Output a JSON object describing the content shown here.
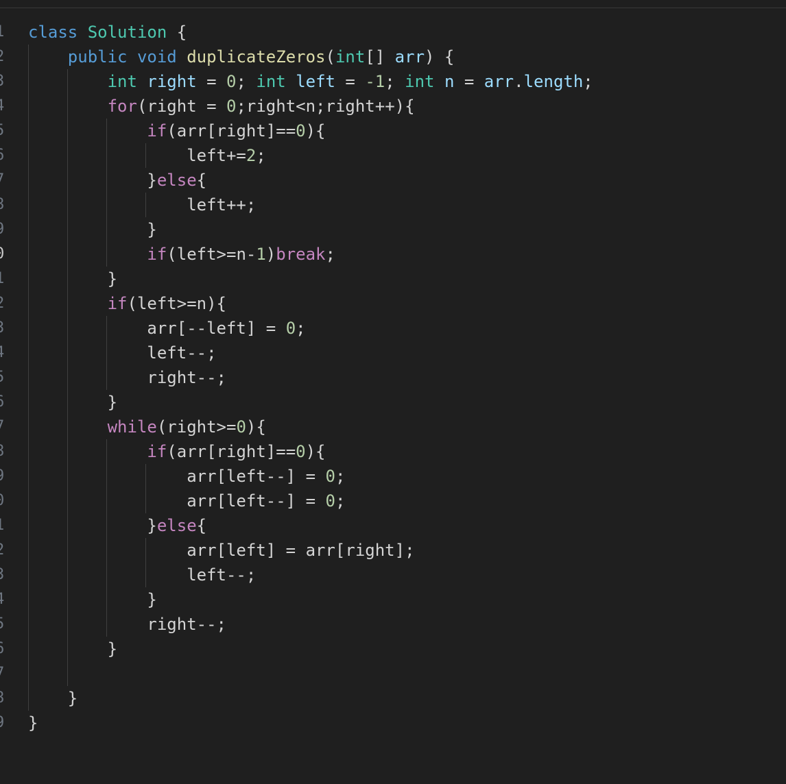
{
  "editor": {
    "line_numbers": [
      "1",
      "2",
      "3",
      "4",
      "5",
      "6",
      "7",
      "8",
      "9",
      "0",
      "1",
      "2",
      "3",
      "4",
      "5",
      "6",
      "7",
      "8",
      "9",
      "0",
      "1",
      "2",
      "3",
      "4",
      "5",
      "6",
      "7",
      "8",
      "9"
    ],
    "active_line_index": 9,
    "language": "java",
    "lines": [
      [
        {
          "t": "class",
          "c": "kw"
        },
        {
          "t": " "
        },
        {
          "t": "Solution",
          "c": "ty"
        },
        {
          "t": " {"
        }
      ],
      [
        {
          "t": "    "
        },
        {
          "t": "public",
          "c": "kw"
        },
        {
          "t": " "
        },
        {
          "t": "void",
          "c": "kw"
        },
        {
          "t": " "
        },
        {
          "t": "duplicateZeros",
          "c": "fn"
        },
        {
          "t": "("
        },
        {
          "t": "int",
          "c": "ty"
        },
        {
          "t": "[] "
        },
        {
          "t": "arr",
          "c": "va"
        },
        {
          "t": ") {"
        }
      ],
      [
        {
          "t": "        "
        },
        {
          "t": "int",
          "c": "ty"
        },
        {
          "t": " "
        },
        {
          "t": "right",
          "c": "va"
        },
        {
          "t": " = "
        },
        {
          "t": "0",
          "c": "nu"
        },
        {
          "t": "; "
        },
        {
          "t": "int",
          "c": "ty"
        },
        {
          "t": " "
        },
        {
          "t": "left",
          "c": "va"
        },
        {
          "t": " = "
        },
        {
          "t": "-1",
          "c": "nu"
        },
        {
          "t": "; "
        },
        {
          "t": "int",
          "c": "ty"
        },
        {
          "t": " "
        },
        {
          "t": "n",
          "c": "va"
        },
        {
          "t": " = "
        },
        {
          "t": "arr",
          "c": "va"
        },
        {
          "t": "."
        },
        {
          "t": "length",
          "c": "va"
        },
        {
          "t": ";"
        }
      ],
      [
        {
          "t": "        "
        },
        {
          "t": "for",
          "c": "cf"
        },
        {
          "t": "(right = "
        },
        {
          "t": "0",
          "c": "nu"
        },
        {
          "t": ";right<n;right++){"
        }
      ],
      [
        {
          "t": "            "
        },
        {
          "t": "if",
          "c": "cf"
        },
        {
          "t": "(arr[right]=="
        },
        {
          "t": "0",
          "c": "nu"
        },
        {
          "t": "){"
        }
      ],
      [
        {
          "t": "                left+="
        },
        {
          "t": "2",
          "c": "nu"
        },
        {
          "t": ";"
        }
      ],
      [
        {
          "t": "            }"
        },
        {
          "t": "else",
          "c": "cf"
        },
        {
          "t": "{"
        }
      ],
      [
        {
          "t": "                left++;"
        }
      ],
      [
        {
          "t": "            }"
        }
      ],
      [
        {
          "t": "            "
        },
        {
          "t": "if",
          "c": "cf"
        },
        {
          "t": "(left>=n-"
        },
        {
          "t": "1",
          "c": "nu"
        },
        {
          "t": ")"
        },
        {
          "t": "break",
          "c": "cf"
        },
        {
          "t": ";"
        }
      ],
      [
        {
          "t": "        }"
        }
      ],
      [
        {
          "t": "        "
        },
        {
          "t": "if",
          "c": "cf"
        },
        {
          "t": "(left>=n){"
        }
      ],
      [
        {
          "t": "            arr[--left] = "
        },
        {
          "t": "0",
          "c": "nu"
        },
        {
          "t": ";"
        }
      ],
      [
        {
          "t": "            left--;"
        }
      ],
      [
        {
          "t": "            right--;"
        }
      ],
      [
        {
          "t": "        }"
        }
      ],
      [
        {
          "t": "        "
        },
        {
          "t": "while",
          "c": "cf"
        },
        {
          "t": "(right>="
        },
        {
          "t": "0",
          "c": "nu"
        },
        {
          "t": "){"
        }
      ],
      [
        {
          "t": "            "
        },
        {
          "t": "if",
          "c": "cf"
        },
        {
          "t": "(arr[right]=="
        },
        {
          "t": "0",
          "c": "nu"
        },
        {
          "t": "){"
        }
      ],
      [
        {
          "t": "                arr[left--] = "
        },
        {
          "t": "0",
          "c": "nu"
        },
        {
          "t": ";"
        }
      ],
      [
        {
          "t": "                arr[left--] = "
        },
        {
          "t": "0",
          "c": "nu"
        },
        {
          "t": ";"
        }
      ],
      [
        {
          "t": "            }"
        },
        {
          "t": "else",
          "c": "cf"
        },
        {
          "t": "{"
        }
      ],
      [
        {
          "t": "                arr[left] = arr[right];"
        }
      ],
      [
        {
          "t": "                left--;"
        }
      ],
      [
        {
          "t": "            }"
        }
      ],
      [
        {
          "t": "            right--;"
        }
      ],
      [
        {
          "t": "        }"
        }
      ],
      [
        {
          "t": ""
        }
      ],
      [
        {
          "t": "    }"
        }
      ],
      [
        {
          "t": "}"
        }
      ]
    ]
  },
  "theme": {
    "background": "#1f1f1f",
    "keyword": "#569cd6",
    "control": "#c586c0",
    "type": "#4ec9b0",
    "function": "#dcdcaa",
    "variable": "#9cdcfe",
    "number": "#b5cea8",
    "text": "#d4d4d4"
  }
}
